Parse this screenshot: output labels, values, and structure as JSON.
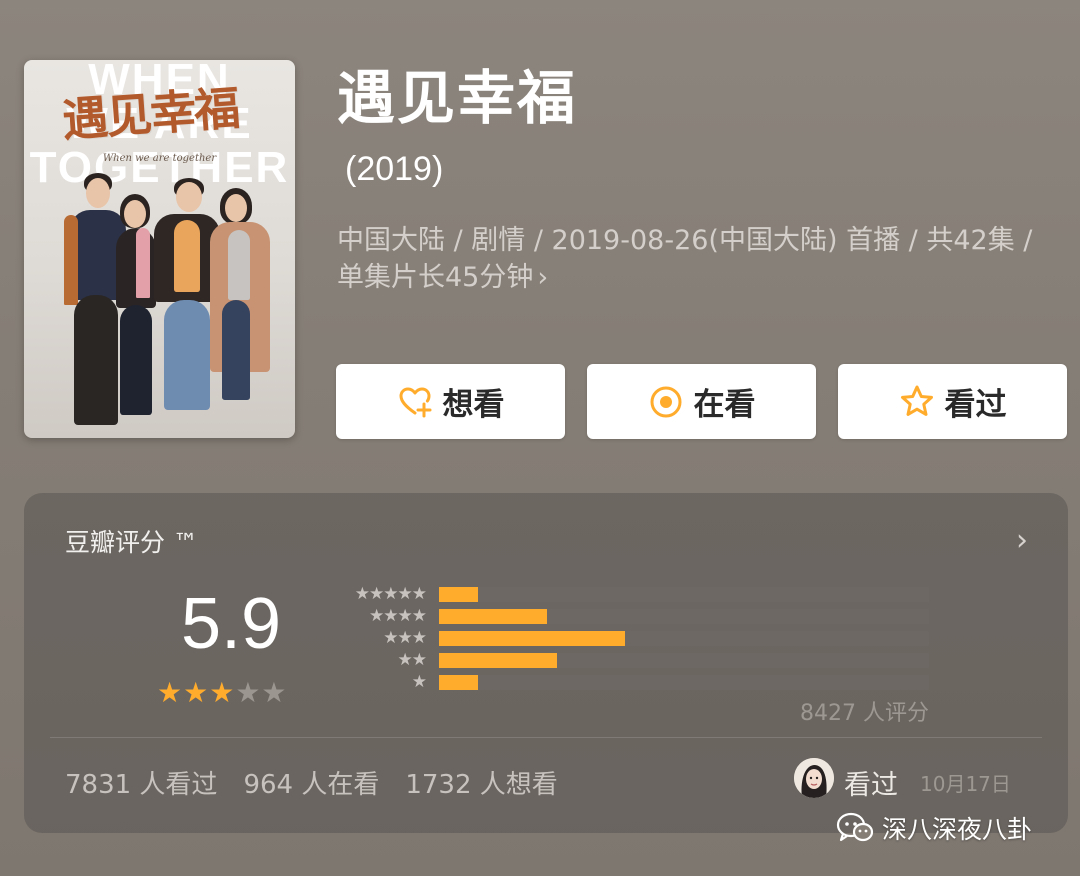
{
  "poster": {
    "bg_line_1": "WHEN",
    "bg_line_2": "WE ARE",
    "bg_line_3": "TOGETHER",
    "title_art": "遇见幸福",
    "subtitle_art": "When we are together"
  },
  "header": {
    "title": "遇见幸福",
    "year": "(2019)",
    "meta": "中国大陆 / 剧情 / 2019-08-26(中国大陆) 首播 / 共42集 / 单集片长45分钟",
    "meta_chevron": "›"
  },
  "actions": {
    "want_label": "想看",
    "watching_label": "在看",
    "watched_label": "看过"
  },
  "rating": {
    "title": "豆瓣评分 ™",
    "chevron": "›",
    "score": "5.9",
    "score_stars": {
      "on": "★★★",
      "off": "★★"
    },
    "distribution": [
      {
        "stars": "★★★★★",
        "fraction": 0.08
      },
      {
        "stars": "★★★★",
        "fraction": 0.22
      },
      {
        "stars": "★★★",
        "fraction": 0.38
      },
      {
        "stars": "★★",
        "fraction": 0.24
      },
      {
        "stars": "★",
        "fraction": 0.08
      }
    ],
    "count": "8427 人评分",
    "stats": [
      "7831 人看过",
      "964 人在看",
      "1732 人想看"
    ],
    "my_status": "看过",
    "my_date": "10月17日"
  },
  "watermark": {
    "text": "深八深夜八卦"
  },
  "colors": {
    "accent": "#ffac2d",
    "background": "#857e76",
    "card": "#5a5652",
    "button": "#ffffff"
  }
}
